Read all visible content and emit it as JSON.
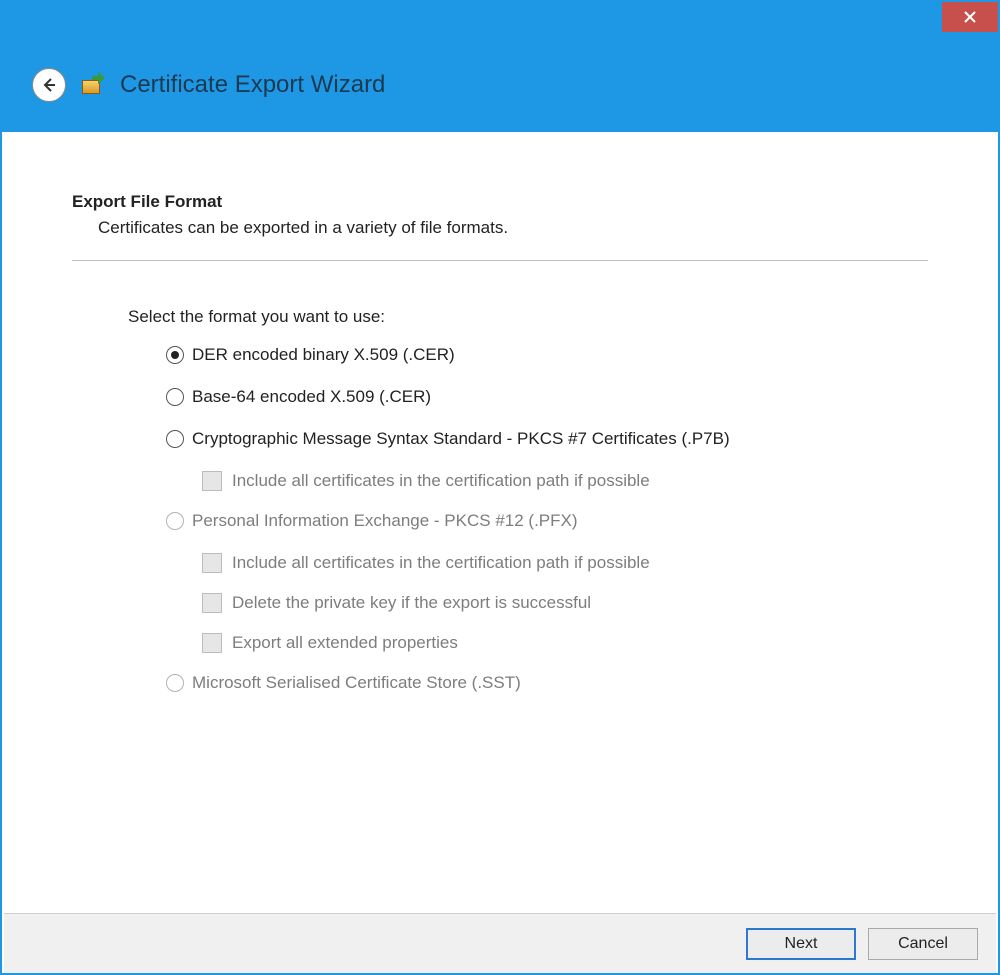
{
  "wizard": {
    "title": "Certificate Export Wizard"
  },
  "section": {
    "heading": "Export File Format",
    "description": "Certificates can be exported in a variety of file formats."
  },
  "prompt": "Select the format you want to use:",
  "options": {
    "der": {
      "label": "DER encoded binary X.509 (.CER)",
      "selected": true,
      "enabled": true
    },
    "b64": {
      "label": "Base-64 encoded X.509 (.CER)",
      "selected": false,
      "enabled": true
    },
    "p7b": {
      "label": "Cryptographic Message Syntax Standard - PKCS #7 Certificates (.P7B)",
      "selected": false,
      "enabled": true
    },
    "p7b_include": {
      "label": "Include all certificates in the certification path if possible",
      "checked": false,
      "enabled": false
    },
    "pfx": {
      "label": "Personal Information Exchange - PKCS #12 (.PFX)",
      "selected": false,
      "enabled": false
    },
    "pfx_include": {
      "label": "Include all certificates in the certification path if possible",
      "checked": false,
      "enabled": false
    },
    "pfx_delete": {
      "label": "Delete the private key if the export is successful",
      "checked": false,
      "enabled": false
    },
    "pfx_ext": {
      "label": "Export all extended properties",
      "checked": false,
      "enabled": false
    },
    "sst": {
      "label": "Microsoft Serialised Certificate Store (.SST)",
      "selected": false,
      "enabled": false
    }
  },
  "buttons": {
    "next": "Next",
    "cancel": "Cancel"
  }
}
